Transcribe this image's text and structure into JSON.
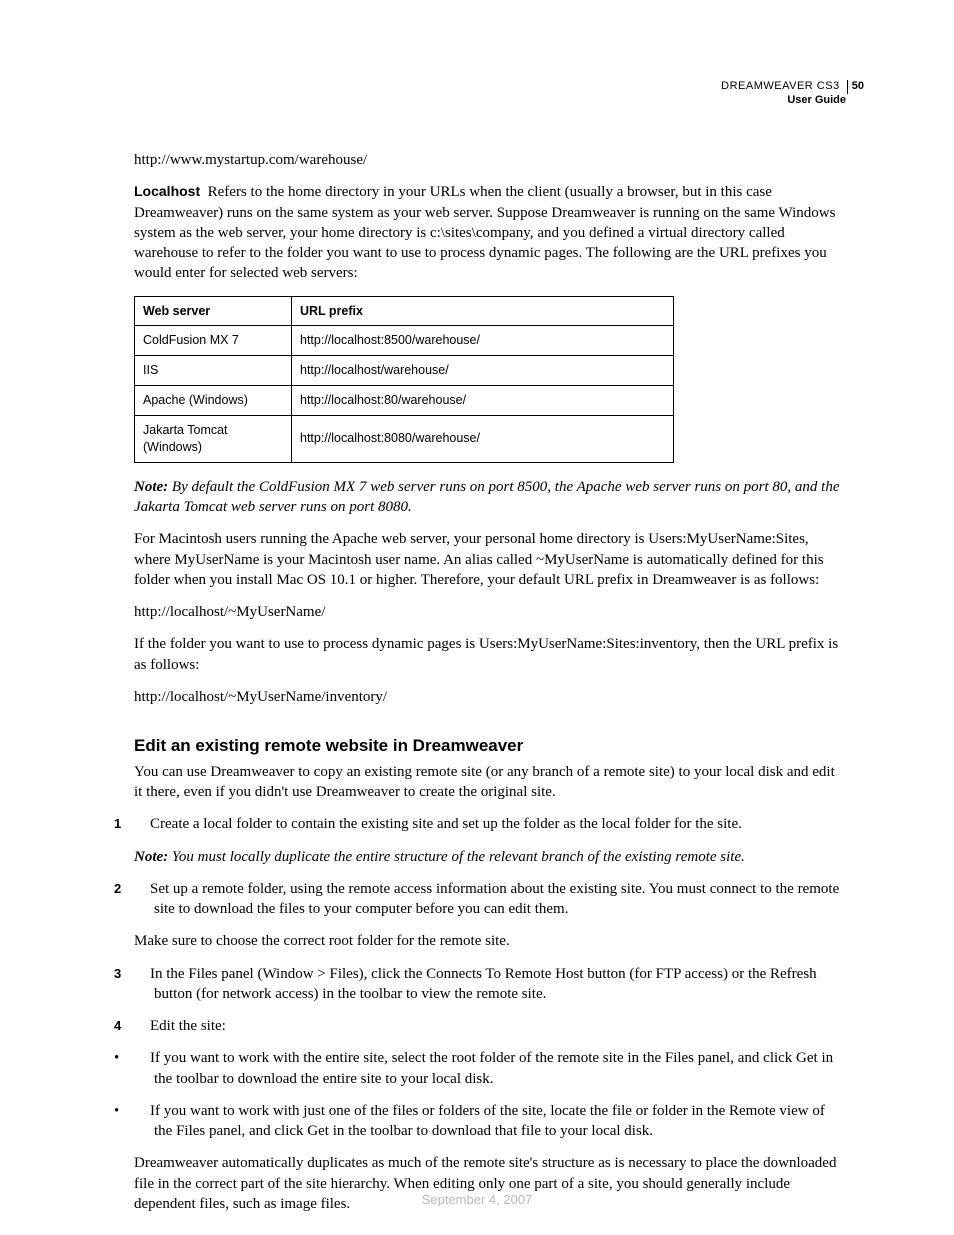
{
  "header": {
    "product": "DREAMWEAVER CS3",
    "page_number": "50",
    "subtitle": "User Guide"
  },
  "intro": {
    "url_example": "http://www.mystartup.com/warehouse/",
    "localhost_label": "Localhost",
    "localhost_para": "Refers to the home directory in your URLs when the client (usually a browser, but in this case Dreamweaver) runs on the same system as your web server. Suppose Dreamweaver is running on the same Windows system as the web server, your home directory is c:\\sites\\company, and you defined a virtual directory called warehouse to refer to the folder you want to use to process dynamic pages. The following are the URL prefixes you would enter for selected web servers:"
  },
  "table": {
    "headers": {
      "col1": "Web server",
      "col2": "URL prefix"
    },
    "rows": [
      {
        "server": "ColdFusion MX 7",
        "prefix": "http://localhost:8500/warehouse/"
      },
      {
        "server": "IIS",
        "prefix": "http://localhost/warehouse/"
      },
      {
        "server": "Apache (Windows)",
        "prefix": "http://localhost:80/warehouse/"
      },
      {
        "server": "Jakarta Tomcat (Windows)",
        "prefix": "http://localhost:8080/warehouse/"
      }
    ]
  },
  "after_table": {
    "note_label": "Note:",
    "note_text": "By default the ColdFusion MX 7 web server runs on port 8500, the Apache web server runs on port 80, and the Jakarta Tomcat web server runs on port 8080.",
    "mac_para": "For Macintosh users running the Apache web server, your personal home directory is Users:MyUserName:Sites, where MyUserName is your Macintosh user name. An alias called ~MyUserName is automatically defined for this folder when you install Mac OS 10.1 or higher. Therefore, your default URL prefix in Dreamweaver is as follows:",
    "mac_url1": "http://localhost/~MyUserName/",
    "mac_para2": "If the folder you want to use to process dynamic pages is Users:MyUserName:Sites:inventory, then the URL prefix is as follows:",
    "mac_url2": "http://localhost/~MyUserName/inventory/"
  },
  "section": {
    "title": "Edit an existing remote website in Dreamweaver",
    "intro": "You can use Dreamweaver to copy an existing remote site (or any branch of a remote site) to your local disk and edit it there, even if you didn't use Dreamweaver to create the original site.",
    "step1_num": "1",
    "step1": "Create a local folder to contain the existing site and set up the folder as the local folder for the site.",
    "step1_note_label": "Note:",
    "step1_note": "You must locally duplicate the entire structure of the relevant branch of the existing remote site.",
    "step2_num": "2",
    "step2": "Set up a remote folder, using the remote access information about the existing site. You must connect to the remote site to download the files to your computer before you can edit them.",
    "step2_extra": "Make sure to choose the correct root folder for the remote site.",
    "step3_num": "3",
    "step3": "In the Files panel (Window > Files), click the Connects To Remote Host button (for FTP access) or the Refresh button (for network access) in the toolbar to view the remote site.",
    "step4_num": "4",
    "step4": "Edit the site:",
    "bullet1": "If you want to work with the entire site, select the root folder of the remote site in the Files panel, and click Get in the toolbar to download the entire site to your local disk.",
    "bullet2": "If you want to work with just one of the files or folders of the site, locate the file or folder in the Remote view of the Files panel, and click Get in the toolbar to download that file to your local disk.",
    "closing": "Dreamweaver automatically duplicates as much of the remote site's structure as is necessary to place the downloaded file in the correct part of the site hierarchy. When editing only one part of a site, you should generally include dependent files, such as image files."
  },
  "footer": {
    "date": "September 4, 2007"
  }
}
